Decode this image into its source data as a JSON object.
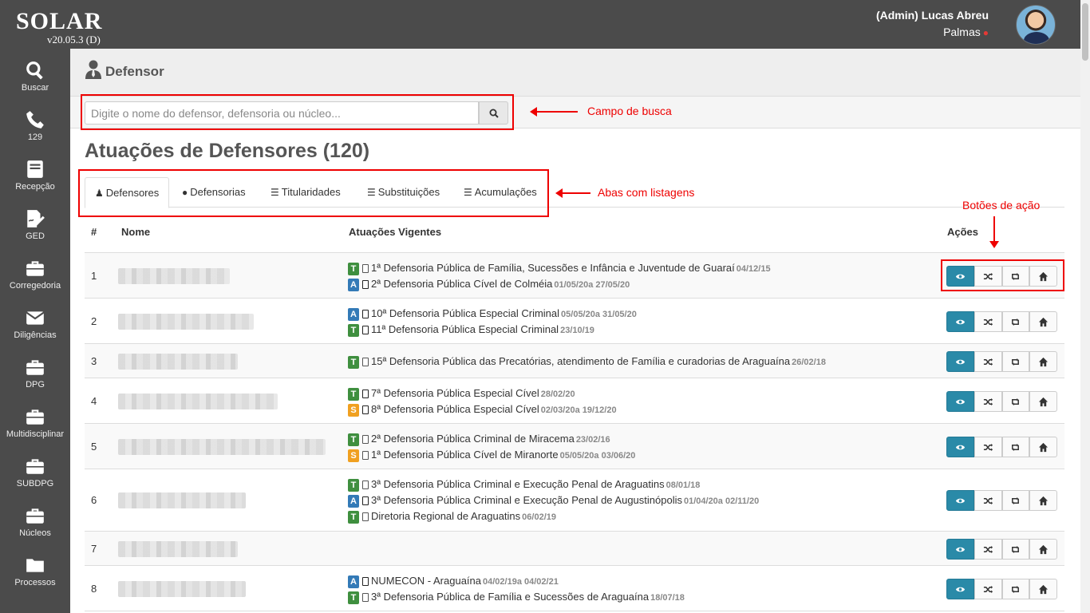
{
  "app": {
    "brand": "SOLAR",
    "version": "v20.05.3 (D)"
  },
  "user": {
    "name": "(Admin) Lucas Abreu",
    "location": "Palmas"
  },
  "sidebar": {
    "items": [
      {
        "label": "Buscar",
        "icon": "search-icon"
      },
      {
        "label": "129",
        "icon": "phone-icon"
      },
      {
        "label": "Recepção",
        "icon": "book-icon"
      },
      {
        "label": "GED",
        "icon": "signature-icon"
      },
      {
        "label": "Corregedoria",
        "icon": "briefcase-icon"
      },
      {
        "label": "Diligências",
        "icon": "envelope-icon"
      },
      {
        "label": "DPG",
        "icon": "briefcase-icon"
      },
      {
        "label": "Multidisciplinar",
        "icon": "briefcase-icon"
      },
      {
        "label": "SUBDPG",
        "icon": "briefcase-icon"
      },
      {
        "label": "Núcleos",
        "icon": "briefcase-icon"
      },
      {
        "label": "Processos",
        "icon": "folder-icon"
      }
    ]
  },
  "page": {
    "title": "Defensor",
    "search_placeholder": "Digite o nome do defensor, defensoria ou núcleo...",
    "heading": "Atuações de Defensores (120)"
  },
  "tabs": [
    {
      "label": "Defensores",
      "icon": "user-icon",
      "active": true
    },
    {
      "label": "Defensorias",
      "icon": "map-marker-icon",
      "active": false
    },
    {
      "label": "Titularidades",
      "icon": "list-icon",
      "active": false
    },
    {
      "label": "Substituições",
      "icon": "list-icon",
      "active": false
    },
    {
      "label": "Acumulações",
      "icon": "list-icon",
      "active": false
    }
  ],
  "table": {
    "headers": {
      "num": "#",
      "name": "Nome",
      "atuacoes": "Atuações Vigentes",
      "acoes": "Ações"
    },
    "rows": [
      {
        "num": "1",
        "atuacoes": [
          {
            "badge": "T",
            "text": "1ª Defensoria Pública de Família, Sucessões e Infância e Juventude de Guaraí",
            "date": "04/12/15"
          },
          {
            "badge": "A",
            "text": "2ª Defensoria Pública Cível de Colméia",
            "date": "01/05/20a 27/05/20"
          }
        ]
      },
      {
        "num": "2",
        "atuacoes": [
          {
            "badge": "A",
            "text": "10ª Defensoria Pública Especial Criminal",
            "date": "05/05/20a 31/05/20"
          },
          {
            "badge": "T",
            "text": "11ª Defensoria Pública Especial Criminal",
            "date": "23/10/19"
          }
        ]
      },
      {
        "num": "3",
        "atuacoes": [
          {
            "badge": "T",
            "text": "15ª Defensoria Pública das Precatórias, atendimento de Família e curadorias de Araguaína",
            "date": "26/02/18"
          }
        ]
      },
      {
        "num": "4",
        "atuacoes": [
          {
            "badge": "T",
            "text": "7ª Defensoria Pública Especial Cível",
            "date": "28/02/20"
          },
          {
            "badge": "S",
            "text": "8ª Defensoria Pública Especial Cível",
            "date": "02/03/20a 19/12/20"
          }
        ]
      },
      {
        "num": "5",
        "atuacoes": [
          {
            "badge": "T",
            "text": "2ª Defensoria Pública Criminal de Miracema",
            "date": "23/02/16"
          },
          {
            "badge": "S",
            "text": "1ª Defensoria Pública Cível de Miranorte",
            "date": "05/05/20a 03/06/20"
          }
        ]
      },
      {
        "num": "6",
        "atuacoes": [
          {
            "badge": "T",
            "text": "3ª Defensoria Pública Criminal e Execução Penal de Araguatins",
            "date": "08/01/18"
          },
          {
            "badge": "A",
            "text": "3ª Defensoria Pública Criminal e Execução Penal de Augustinópolis",
            "date": "01/04/20a 02/11/20"
          },
          {
            "badge": "T",
            "text": "Diretoria Regional de Araguatins",
            "date": "06/02/19"
          }
        ]
      },
      {
        "num": "7",
        "atuacoes": []
      },
      {
        "num": "8",
        "atuacoes": [
          {
            "badge": "A",
            "text": "NUMECON - Araguaína",
            "date": "04/02/19a 04/02/21"
          },
          {
            "badge": "T",
            "text": "3ª Defensoria Pública de Família e Sucessões de Araguaína",
            "date": "18/07/18"
          }
        ]
      }
    ],
    "action_icons": [
      "eye-icon",
      "shuffle-icon",
      "retweet-icon",
      "home-icon"
    ]
  },
  "annotations": {
    "search": "Campo de busca",
    "tabs": "Abas com listagens",
    "actions": "Botões de ação"
  },
  "colors": {
    "sidebar": "#4b4b4b",
    "accent": "#2a8aa8",
    "badge_T": "#3f8f3f",
    "badge_A": "#337ab7",
    "badge_S": "#f0a020",
    "annotation": "#ee0000"
  }
}
